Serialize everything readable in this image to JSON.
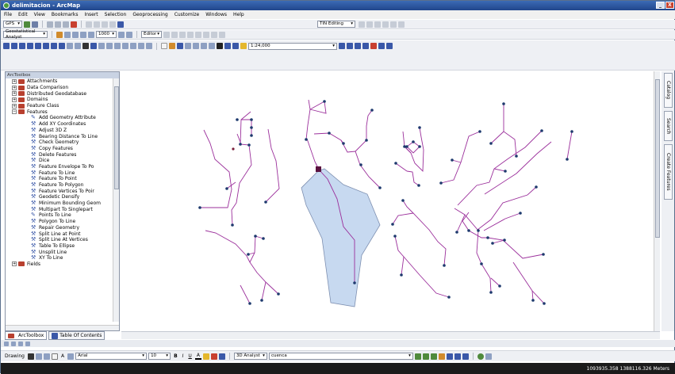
{
  "window": {
    "title": "delimitacion - ArcMap",
    "minimize": "_",
    "close": "X"
  },
  "menu": [
    "File",
    "Edit",
    "View",
    "Bookmarks",
    "Insert",
    "Selection",
    "Geoprocessing",
    "Customize",
    "Windows",
    "Help"
  ],
  "toolbar1": {
    "gps": "GPS",
    "tin_editing": "TIN Editing"
  },
  "toolbar2": {
    "geostat": "Geostatistical Analyst",
    "zoom": "1000",
    "editor": "Editor"
  },
  "toolbar3": {
    "scale": "1:24,000"
  },
  "toolbox": {
    "header": "ArcToolbox",
    "items": [
      {
        "type": "toolbox",
        "expander": "+",
        "label": "Attachments"
      },
      {
        "type": "toolbox",
        "expander": "+",
        "label": "Data Comparison"
      },
      {
        "type": "toolbox",
        "expander": "+",
        "label": "Distributed Geodatabase"
      },
      {
        "type": "toolbox",
        "expander": "+",
        "label": "Domains"
      },
      {
        "type": "toolbox",
        "expander": "+",
        "label": "Feature Class"
      },
      {
        "type": "toolbox",
        "expander": "−",
        "label": "Features"
      },
      {
        "type": "script",
        "label": "Add Geometry Attribute"
      },
      {
        "type": "tool",
        "label": "Add XY Coordinates"
      },
      {
        "type": "tool",
        "label": "Adjust 3D Z"
      },
      {
        "type": "tool",
        "label": "Bearing Distance To Line"
      },
      {
        "type": "tool",
        "label": "Check Geometry"
      },
      {
        "type": "tool",
        "label": "Copy Features"
      },
      {
        "type": "tool",
        "label": "Delete Features"
      },
      {
        "type": "tool",
        "label": "Dice"
      },
      {
        "type": "tool",
        "label": "Feature Envelope To Po"
      },
      {
        "type": "tool",
        "label": "Feature To Line"
      },
      {
        "type": "tool",
        "label": "Feature To Point"
      },
      {
        "type": "tool",
        "label": "Feature To Polygon"
      },
      {
        "type": "tool",
        "label": "Feature Vertices To Poir"
      },
      {
        "type": "tool",
        "label": "Geodetic Densify"
      },
      {
        "type": "tool",
        "label": "Minimum Bounding Geom"
      },
      {
        "type": "tool",
        "label": "Multipart To Singlepart"
      },
      {
        "type": "script",
        "label": "Points To Line"
      },
      {
        "type": "tool",
        "label": "Polygon To Line"
      },
      {
        "type": "tool",
        "label": "Repair Geometry"
      },
      {
        "type": "tool",
        "label": "Split Line at Point"
      },
      {
        "type": "tool",
        "label": "Split Line At Vertices"
      },
      {
        "type": "tool",
        "label": "Table To Ellipse"
      },
      {
        "type": "tool",
        "label": "Unsplit Line"
      },
      {
        "type": "tool",
        "label": "XY To Line"
      },
      {
        "type": "toolbox",
        "expander": "+",
        "label": "Fields"
      }
    ]
  },
  "tabs": {
    "toolbox": "ArcToolbox",
    "toc": "Table Of Contents"
  },
  "right_dock": {
    "catalog": "Catalog",
    "search": "Search",
    "create_features": "Create Features"
  },
  "drawing": {
    "drawing": "Drawing",
    "font": "Arial",
    "size": "10",
    "bold": "B",
    "italic": "I",
    "underline": "U",
    "text_a": "A",
    "analyst3d": "3D Analyst",
    "layer": "cuenca"
  },
  "status": {
    "coordinates": "1093935.358  1388116.326 Meters"
  },
  "colors": {
    "stream": "#9b2f9b",
    "basin_fill": "#c7d9f0",
    "basin_stroke": "#7d8fb0",
    "node": "#1e3a6e"
  }
}
